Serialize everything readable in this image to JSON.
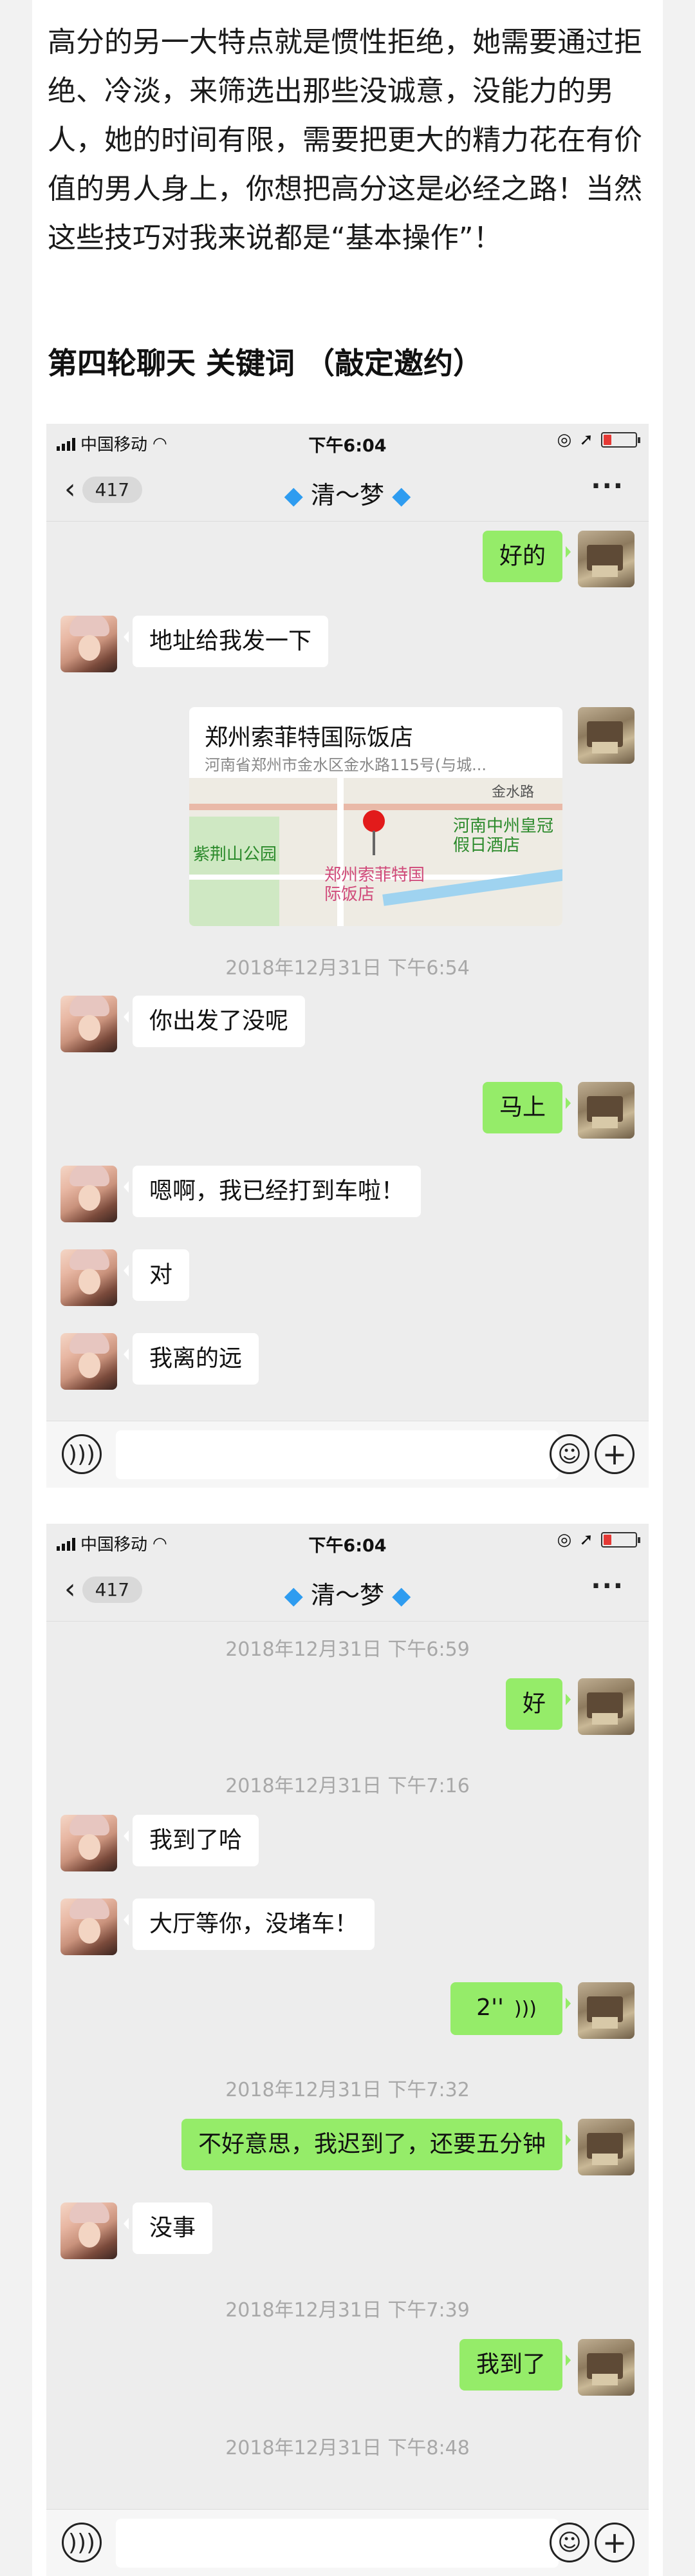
{
  "article": {
    "paragraph": "高分的另一大特点就是惯性拒绝，她需要通过拒绝、冷淡，来筛选出那些没诚意，没能力的男人，她的时间有限，需要把更大的精力花在有价值的男人身上，你想把高分这是必经之路！当然这些技巧对我来说都是“基本操作”！",
    "heading": "第四轮聊天 关键词 （敲定邀约）"
  },
  "status_bar": {
    "carrier": "中国移动",
    "time": "下午6:04"
  },
  "nav": {
    "back_count": "417",
    "contact_name": "清～梦"
  },
  "chat1": {
    "msg_ok": "好的",
    "msg_send_addr": "地址给我发一下",
    "location_name": "郑州索菲特国际饭店",
    "location_address": "河南省郑州市金水区金水路115号(与城...",
    "map_labels": {
      "park": "紫荆山公园",
      "hotel": "郑州索菲特国际饭店",
      "holiday": "河南中州皇冠假日酒店",
      "road": "金水路"
    },
    "time1": "2018年12月31日 下午6:54",
    "msg_leave": "你出发了没呢",
    "msg_now": "马上",
    "msg_taxi": "嗯啊，我已经打到车啦！",
    "msg_right": "对",
    "msg_far": "我离的远"
  },
  "chat2": {
    "time1": "2018年12月31日 下午6:59",
    "msg_ok": "好",
    "time2": "2018年12月31日 下午7:16",
    "msg_arrived": "我到了哈",
    "msg_lobby": "大厅等你，没堵车！",
    "voice_len": "2''",
    "time3": "2018年12月31日 下午7:32",
    "msg_late": "不好意思，我迟到了，还要五分钟",
    "msg_noproblem": "没事",
    "time4": "2018年12月31日 下午7:39",
    "msg_here": "我到了",
    "time5": "2018年12月31日 下午8:48"
  }
}
